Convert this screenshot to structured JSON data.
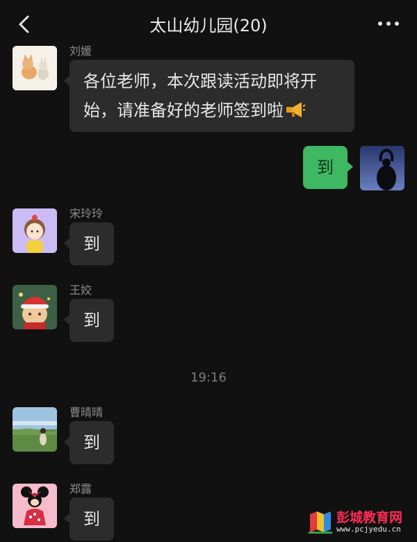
{
  "header": {
    "title": "太山幼儿园(20)",
    "back_icon": "chevron-left-icon",
    "more_icon": "more-dots-icon"
  },
  "messages": [
    {
      "sender": "刘媛",
      "text": "各位老师，本次跟读活动即将开始，请准备好的老师签到啦",
      "emoji": "megaphone-emoji"
    },
    {
      "sender": "",
      "text": "到",
      "mine": true
    },
    {
      "sender": "宋玲玲",
      "text": "到"
    },
    {
      "sender": "王姣",
      "text": "到"
    },
    {
      "sender": "曹晴晴",
      "text": "到"
    },
    {
      "sender": "郑露",
      "text": "到"
    }
  ],
  "timestamp": "19:16",
  "watermark": {
    "title": "彭城教育网",
    "url": "www.pcjyedu.cn"
  },
  "colors": {
    "background": "#111111",
    "bubble_received": "#2c2c2c",
    "bubble_sent": "#3eb862"
  }
}
